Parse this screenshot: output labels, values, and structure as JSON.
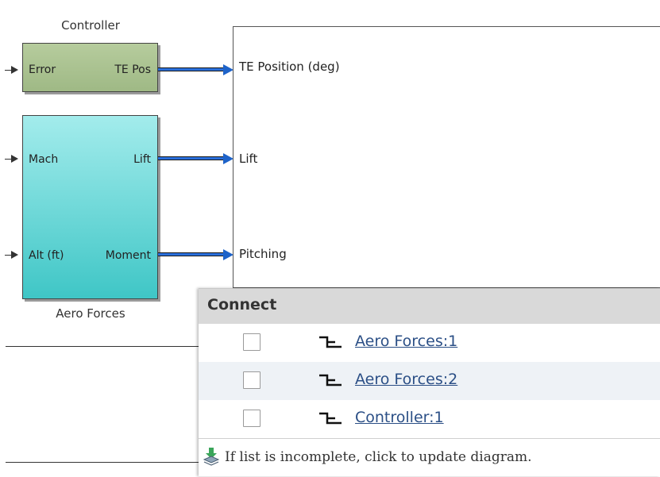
{
  "controller": {
    "title": "Controller",
    "in_port": "Error",
    "out_port": "TE Pos",
    "color": "#a9c190"
  },
  "aero_forces": {
    "title": "Aero Forces",
    "in_ports": [
      "Mach",
      "Alt (ft)"
    ],
    "out_ports": [
      "Lift",
      "Moment"
    ],
    "color": "#8ee3e3"
  },
  "scope": {
    "inputs": [
      "TE Position (deg)",
      "Lift",
      "Pitching"
    ]
  },
  "signal_color": "#2a6fdc",
  "connect_popup": {
    "title": "Connect",
    "rows": [
      {
        "label": "Aero Forces:1",
        "checked": false,
        "icon": "output-port-icon"
      },
      {
        "label": "Aero Forces:2",
        "checked": false,
        "icon": "output-port-icon"
      },
      {
        "label": "Controller:1",
        "checked": false,
        "icon": "output-port-icon"
      }
    ],
    "footer_text": "If list is incomplete, click to update diagram.",
    "footer_icon": "update-diagram-icon"
  }
}
